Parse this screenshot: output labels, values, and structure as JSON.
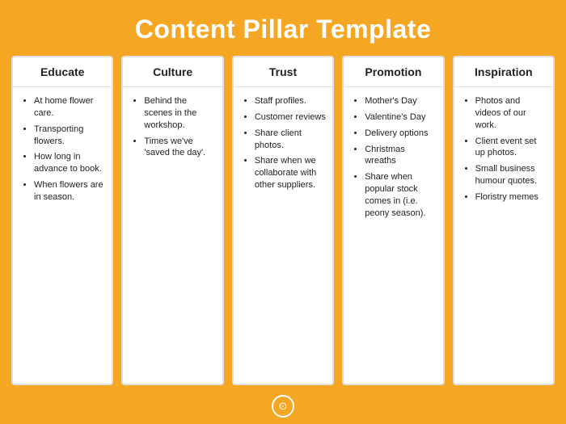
{
  "page": {
    "title": "Content Pillar Template",
    "background_color": "#F5A623"
  },
  "pillars": [
    {
      "id": "educate",
      "header": "Educate",
      "items": [
        "At home flower care.",
        "Transporting flowers.",
        "How long in advance to book.",
        "When flowers are in season."
      ]
    },
    {
      "id": "culture",
      "header": "Culture",
      "items": [
        "Behind the scenes in the workshop.",
        "Times we've 'saved the day'."
      ]
    },
    {
      "id": "trust",
      "header": "Trust",
      "items": [
        "Staff profiles.",
        "Customer reviews",
        "Share client photos.",
        "Share when we collaborate with other suppliers."
      ]
    },
    {
      "id": "promotion",
      "header": "Promotion",
      "items": [
        "Mother's Day",
        "Valentine's Day",
        "Delivery options",
        "Christmas wreaths",
        "Share when popular stock comes in (i.e. peony season)."
      ]
    },
    {
      "id": "inspiration",
      "header": "Inspiration",
      "items": [
        "Photos and videos of our work.",
        "Client event set up photos.",
        "Small business humour quotes.",
        "Floristry memes"
      ]
    }
  ],
  "footer": {
    "icon": "©"
  }
}
